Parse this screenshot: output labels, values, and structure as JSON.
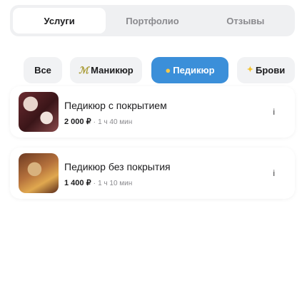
{
  "segments": [
    {
      "label": "Услуги",
      "active": true
    },
    {
      "label": "Портфолио",
      "active": false
    },
    {
      "label": "Отзывы",
      "active": false
    }
  ],
  "categories": {
    "all": {
      "label": "Все"
    },
    "manicure": {
      "label": "Маникюр",
      "icon": "nail-polish-icon"
    },
    "pedicure": {
      "label": "Педикюр",
      "icon": "foot-icon",
      "active": true
    },
    "brows": {
      "label": "Брови",
      "icon": "sparkle-icon"
    }
  },
  "services": [
    {
      "title": "Педикюр с покрытием",
      "price": "2 000 ₽",
      "separator": "·",
      "duration": "1 ч 40 мин"
    },
    {
      "title": "Педикюр без покрытия",
      "price": "1 400 ₽",
      "separator": "·",
      "duration": "1 ч 10 мин"
    }
  ],
  "colors": {
    "accent": "#3b8fd9",
    "chip_bg": "#f1f2f4",
    "segment_bg": "#eff0f2"
  }
}
